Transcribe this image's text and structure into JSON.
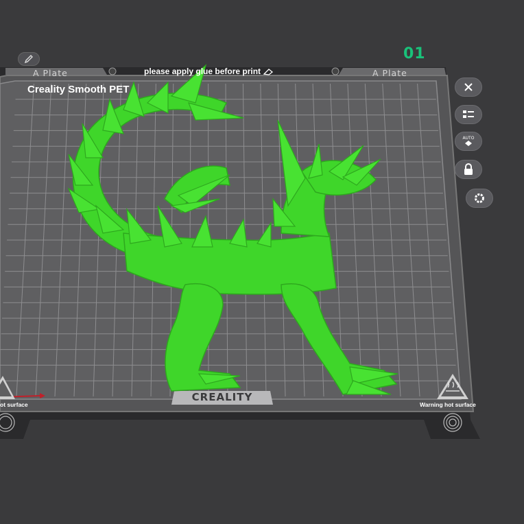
{
  "plate": {
    "number": "01",
    "left_tab_label": "A Plate",
    "right_tab_label": "A Plate",
    "tip_text": "please apply glue before print",
    "filament_label": "Creality Smooth PET",
    "brand": "CREALITY",
    "warning_left": "ot surface",
    "warning_right": "Warning hot surface"
  },
  "toolbar": {
    "items": [
      {
        "name": "close",
        "icon": "close-icon"
      },
      {
        "name": "arrange",
        "icon": "list-icon"
      },
      {
        "name": "auto-orient",
        "icon": "auto-icon",
        "label": "AUTO"
      },
      {
        "name": "lock",
        "icon": "lock-icon"
      },
      {
        "name": "settings",
        "icon": "gear-icon"
      }
    ]
  },
  "colors": {
    "background": "#3a3a3c",
    "plate": "#5f5f61",
    "grid": "#9a9a9c",
    "model": "#3fd62a",
    "accent": "#19c27a",
    "x_axis": "#c0202a"
  }
}
